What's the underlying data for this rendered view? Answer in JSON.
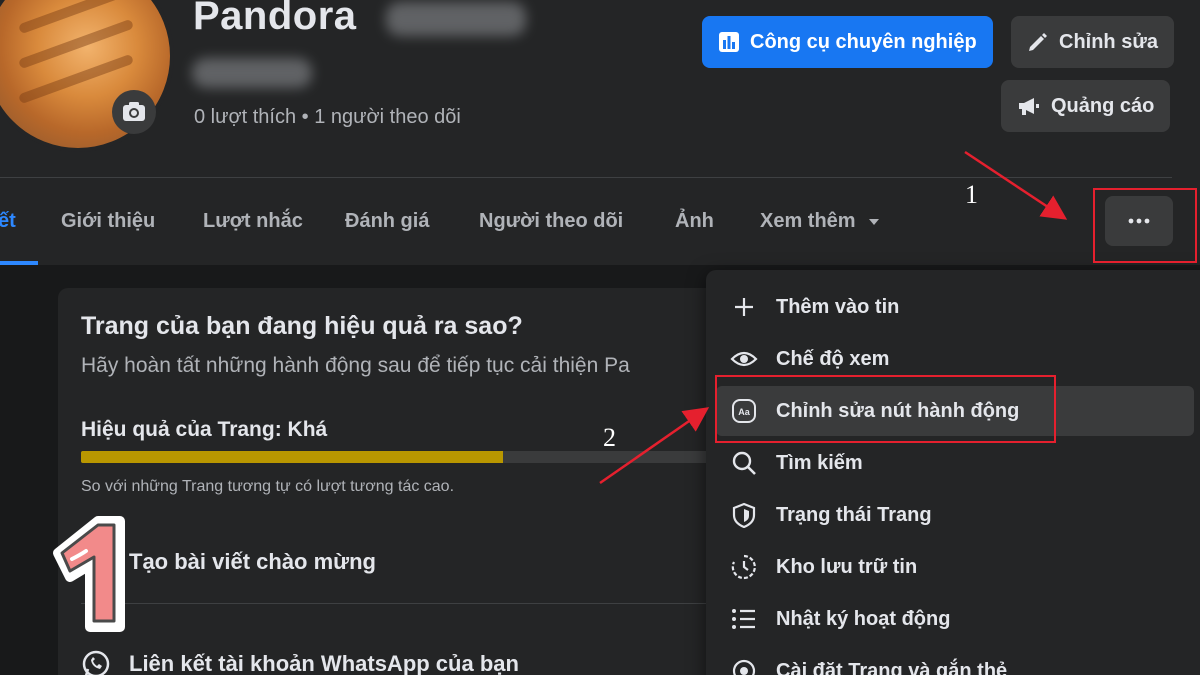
{
  "page": {
    "name": "Pandora",
    "stats": "0 lượt thích • 1 người theo dõi"
  },
  "actions": {
    "professional_tools": "Công cụ chuyên nghiệp",
    "edit": "Chỉnh sửa",
    "advertise": "Quảng cáo"
  },
  "tabs": [
    {
      "label": "ết",
      "active": true
    },
    {
      "label": "Giới thiệu"
    },
    {
      "label": "Lượt nhắc"
    },
    {
      "label": "Đánh giá"
    },
    {
      "label": "Người theo dõi"
    },
    {
      "label": "Ảnh"
    },
    {
      "label": "Xem thêm"
    }
  ],
  "performance_card": {
    "title": "Trang của bạn đang hiệu quả ra sao?",
    "subtitle": "Hãy hoàn tất những hành động sau để tiếp tục cải thiện Pa",
    "level_label": "Hiệu quả của Trang: Khá",
    "progress": 0.66,
    "compare_text": "So với những Trang tương tự có lượt tương tác cao.",
    "tasks": [
      {
        "label": "Tạo bài viết chào mừng",
        "icon": "edit-post-icon"
      },
      {
        "label": "Liên kết tài khoản WhatsApp của bạn",
        "icon": "whatsapp-icon"
      }
    ]
  },
  "menu": {
    "items": [
      {
        "label": "Thêm vào tin",
        "icon": "plus-icon"
      },
      {
        "label": "Chế độ xem",
        "icon": "eye-icon"
      },
      {
        "label": "Chỉnh sửa nút hành động",
        "icon": "action-button-icon"
      },
      {
        "label": "Tìm kiếm",
        "icon": "search-icon"
      },
      {
        "label": "Trạng thái Trang",
        "icon": "shield-icon"
      },
      {
        "label": "Kho lưu trữ tin",
        "icon": "archive-clock-icon"
      },
      {
        "label": "Nhật ký hoạt động",
        "icon": "list-icon"
      },
      {
        "label": "Cài đặt Trang và gắn thẻ",
        "icon": "settings-gear-icon"
      }
    ]
  },
  "annotations": {
    "step1": "1",
    "step2": "2",
    "sticker": "1"
  },
  "colors": {
    "accent": "#1877f2",
    "annotation_red": "#e5202e",
    "progress": "#b99700"
  }
}
